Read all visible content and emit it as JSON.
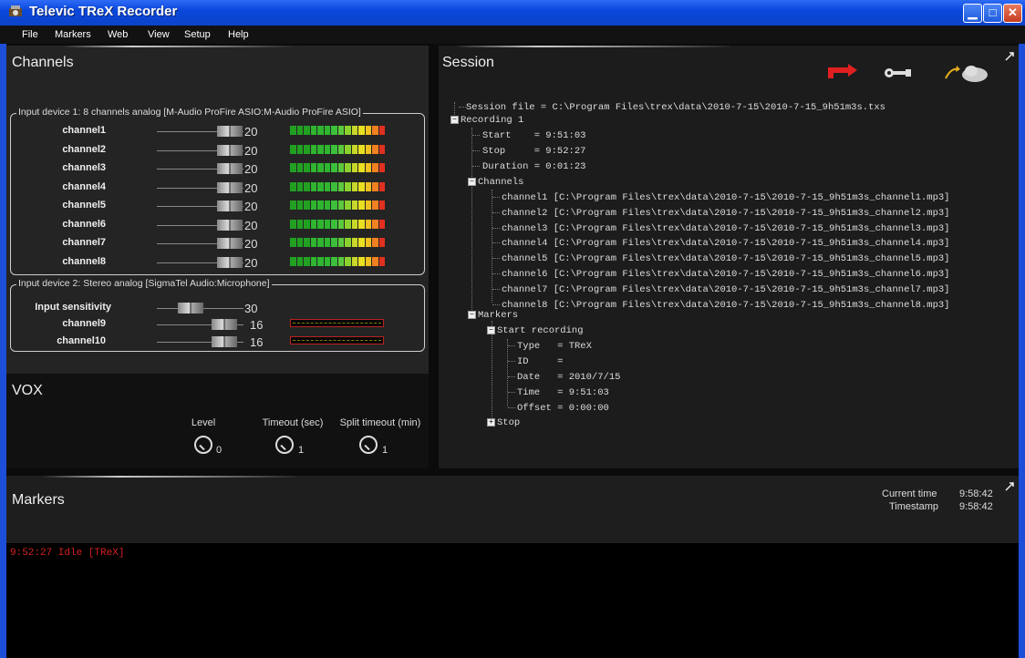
{
  "window": {
    "title": "Televic TReX Recorder"
  },
  "menu": [
    "File",
    "Markers",
    "Web",
    "View",
    "Setup",
    "Help"
  ],
  "channels": {
    "title": "Channels",
    "device1": {
      "legend": "Input device 1: 8 channels analog [M-Audio ProFire ASIO:M-Audio ProFire ASIO]",
      "rows": [
        {
          "label": "channel1",
          "value": "20"
        },
        {
          "label": "channel2",
          "value": "20"
        },
        {
          "label": "channel3",
          "value": "20"
        },
        {
          "label": "channel4",
          "value": "20"
        },
        {
          "label": "channel5",
          "value": "20"
        },
        {
          "label": "channel6",
          "value": "20"
        },
        {
          "label": "channel7",
          "value": "20"
        },
        {
          "label": "channel8",
          "value": "20"
        }
      ]
    },
    "device2": {
      "legend": "Input device 2: Stereo analog [SigmaTel Audio:Microphone]",
      "sensitivity_label": "Input sensitivity",
      "sensitivity_value": "30",
      "rows": [
        {
          "label": "channel9",
          "value": "16"
        },
        {
          "label": "channel10",
          "value": "16"
        }
      ]
    }
  },
  "vox": {
    "title": "VOX",
    "level": {
      "label": "Level",
      "value": "0"
    },
    "timeout": {
      "label": "Timeout (sec)",
      "value": "1"
    },
    "split": {
      "label": "Split timeout (min)",
      "value": "1"
    }
  },
  "session": {
    "title": "Session",
    "lines": [
      "Session file = C:\\Program Files\\trex\\data\\2010-7-15\\2010-7-15_9h51m3s.txs",
      "Recording 1",
      "Start    = 9:51:03",
      "Stop     = 9:52:27",
      "Duration = 0:01:23",
      "Channels",
      "channel1 [C:\\Program Files\\trex\\data\\2010-7-15\\2010-7-15_9h51m3s_channel1.mp3]",
      "channel2 [C:\\Program Files\\trex\\data\\2010-7-15\\2010-7-15_9h51m3s_channel2.mp3]",
      "channel3 [C:\\Program Files\\trex\\data\\2010-7-15\\2010-7-15_9h51m3s_channel3.mp3]",
      "channel4 [C:\\Program Files\\trex\\data\\2010-7-15\\2010-7-15_9h51m3s_channel4.mp3]",
      "channel5 [C:\\Program Files\\trex\\data\\2010-7-15\\2010-7-15_9h51m3s_channel5.mp3]",
      "channel6 [C:\\Program Files\\trex\\data\\2010-7-15\\2010-7-15_9h51m3s_channel6.mp3]",
      "channel7 [C:\\Program Files\\trex\\data\\2010-7-15\\2010-7-15_9h51m3s_channel7.mp3]",
      "channel8 [C:\\Program Files\\trex\\data\\2010-7-15\\2010-7-15_9h51m3s_channel8.mp3]",
      "Markers",
      "Start recording",
      "Type   = TReX",
      "ID     =",
      "Date   = 2010/7/15",
      "Time   = 9:51:03",
      "Offset = 0:00:00",
      "Stop"
    ]
  },
  "markers": {
    "title": "Markers",
    "current_time_label": "Current time",
    "current_time": "9:58:42",
    "timestamp_label": "Timestamp",
    "timestamp": "9:58:42",
    "entries": [
      "9:52:27 Idle [TReX]"
    ]
  },
  "colors": {
    "titlebar": "#0a47dc",
    "marker_text": "#d42020",
    "accent_red": "#e02020"
  }
}
